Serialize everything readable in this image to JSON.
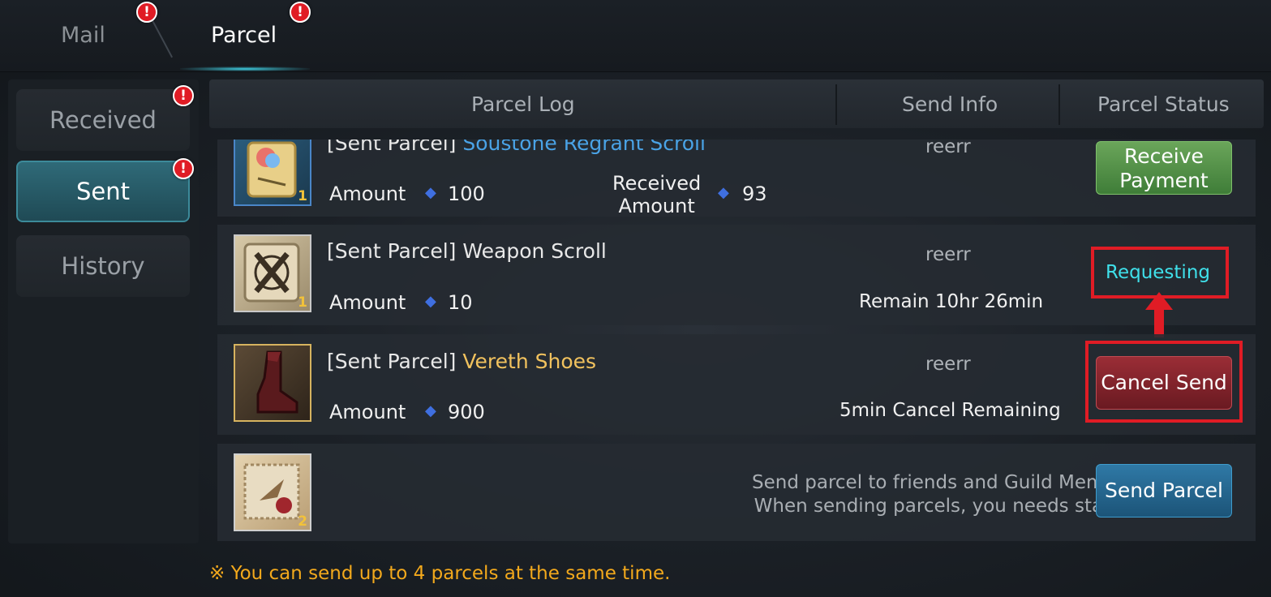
{
  "tabs": {
    "mail": "Mail",
    "parcel": "Parcel",
    "badge": "!"
  },
  "sidebar": {
    "received": "Received",
    "sent": "Sent",
    "history": "History"
  },
  "table_header": {
    "log": "Parcel Log",
    "send_info": "Send Info",
    "status": "Parcel Status"
  },
  "rows": [
    {
      "prefix": "[Sent Parcel]",
      "item": "Soustone Regrant Scroll",
      "item_qty": "1",
      "amount_label": "Amount",
      "amount": "100",
      "received_label_1": "Received",
      "received_label_2": "Amount",
      "received_amount": "93",
      "sender": "reerr",
      "button": {
        "line1": "Receive",
        "line2": "Payment"
      }
    },
    {
      "prefix": "[Sent Parcel]",
      "item": "Weapon Scroll",
      "item_qty": "1",
      "amount_label": "Amount",
      "amount": "10",
      "sender": "reerr",
      "info": "Remain 10hr 26min",
      "status": "Requesting"
    },
    {
      "prefix": "[Sent Parcel]",
      "item": "Vereth Shoes",
      "item_qty": "",
      "amount_label": "Amount",
      "amount": "900",
      "sender": "reerr",
      "info": "5min Cancel Remaining",
      "button": "Cancel Send"
    }
  ],
  "send_row": {
    "stamp_qty": "2",
    "line1": "Send parcel to friends and Guild Members.",
    "line2": "When sending parcels, you needs stamps.",
    "button": "Send Parcel"
  },
  "footer_note": "※ You can send up to 4 parcels at the same time.",
  "colors": {
    "accent_cyan": "#3fe0ea",
    "highlight_red": "#e01c25",
    "note_orange": "#f3a91c",
    "rare_blue": "#4aa3e6",
    "legendary_gold": "#f1c25e"
  }
}
